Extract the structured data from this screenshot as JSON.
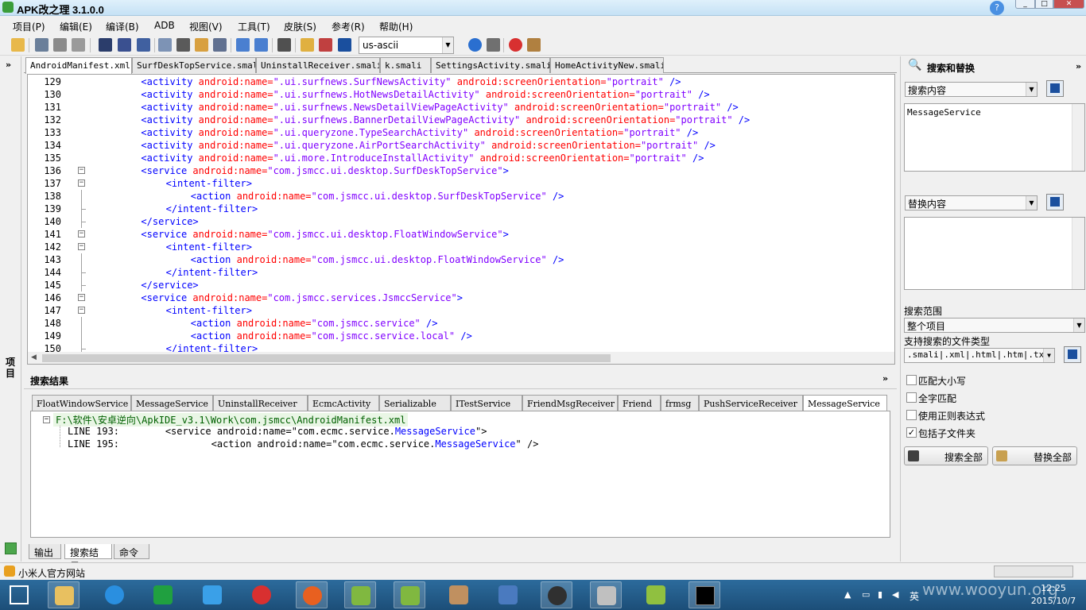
{
  "window": {
    "title": "APK改之理 3.1.0.0",
    "help_icon": "help-icon"
  },
  "menu": [
    "项目(P)",
    "编辑(E)",
    "编译(B)",
    "ADB",
    "视图(V)",
    "工具(T)",
    "皮肤(S)",
    "参考(R)",
    "帮助(H)"
  ],
  "toolbar": {
    "encoding": "us-ascii"
  },
  "left_panel": {
    "label": "项目"
  },
  "editor_tabs": [
    "AndroidManifest.xml",
    "SurfDeskTopService.smali",
    "UninstallReceiver.smali",
    "k.smali",
    "SettingsActivity.smali",
    "HomeActivityNew.smali"
  ],
  "editor": {
    "lines": [
      {
        "n": "129",
        "indent": 2,
        "parts": [
          [
            "t",
            "<activity "
          ],
          [
            "a",
            "android:name="
          ],
          [
            "v",
            "\".ui.surfnews.SurfNewsActivity\" "
          ],
          [
            "a",
            "android:screenOrientation="
          ],
          [
            "v",
            "\"portrait\" "
          ],
          [
            "t",
            "/>"
          ]
        ]
      },
      {
        "n": "130",
        "indent": 2,
        "parts": [
          [
            "t",
            "<activity "
          ],
          [
            "a",
            "android:name="
          ],
          [
            "v",
            "\".ui.surfnews.HotNewsDetailActivity\" "
          ],
          [
            "a",
            "android:screenOrientation="
          ],
          [
            "v",
            "\"portrait\" "
          ],
          [
            "t",
            "/>"
          ]
        ]
      },
      {
        "n": "131",
        "indent": 2,
        "parts": [
          [
            "t",
            "<activity "
          ],
          [
            "a",
            "android:name="
          ],
          [
            "v",
            "\".ui.surfnews.NewsDetailViewPageActivity\" "
          ],
          [
            "a",
            "android:screenOrientation="
          ],
          [
            "v",
            "\"portrait\" "
          ],
          [
            "t",
            "/>"
          ]
        ]
      },
      {
        "n": "132",
        "indent": 2,
        "parts": [
          [
            "t",
            "<activity "
          ],
          [
            "a",
            "android:name="
          ],
          [
            "v",
            "\".ui.surfnews.BannerDetailViewPageActivity\" "
          ],
          [
            "a",
            "android:screenOrientation="
          ],
          [
            "v",
            "\"portrait\" "
          ],
          [
            "t",
            "/>"
          ]
        ]
      },
      {
        "n": "133",
        "indent": 2,
        "parts": [
          [
            "t",
            "<activity "
          ],
          [
            "a",
            "android:name="
          ],
          [
            "v",
            "\".ui.queryzone.TypeSearchActivity\" "
          ],
          [
            "a",
            "android:screenOrientation="
          ],
          [
            "v",
            "\"portrait\" "
          ],
          [
            "t",
            "/>"
          ]
        ]
      },
      {
        "n": "134",
        "indent": 2,
        "parts": [
          [
            "t",
            "<activity "
          ],
          [
            "a",
            "android:name="
          ],
          [
            "v",
            "\".ui.queryzone.AirPortSearchActivity\" "
          ],
          [
            "a",
            "android:screenOrientation="
          ],
          [
            "v",
            "\"portrait\" "
          ],
          [
            "t",
            "/>"
          ]
        ]
      },
      {
        "n": "135",
        "indent": 2,
        "parts": [
          [
            "t",
            "<activity "
          ],
          [
            "a",
            "android:name="
          ],
          [
            "v",
            "\".ui.more.IntroduceInstallActivity\" "
          ],
          [
            "a",
            "android:screenOrientation="
          ],
          [
            "v",
            "\"portrait\" "
          ],
          [
            "t",
            "/>"
          ]
        ]
      },
      {
        "n": "136",
        "indent": 2,
        "fold": "box",
        "parts": [
          [
            "t",
            "<service "
          ],
          [
            "a",
            "android:name="
          ],
          [
            "v",
            "\"com.jsmcc.ui.desktop.SurfDeskTopService\""
          ],
          [
            "t",
            ">"
          ]
        ]
      },
      {
        "n": "137",
        "indent": 3,
        "fold": "box",
        "parts": [
          [
            "t",
            "<intent-filter>"
          ]
        ]
      },
      {
        "n": "138",
        "indent": 4,
        "fold": "line",
        "parts": [
          [
            "t",
            "<action "
          ],
          [
            "a",
            "android:name="
          ],
          [
            "v",
            "\"com.jsmcc.ui.desktop.SurfDeskTopService\" "
          ],
          [
            "t",
            "/>"
          ]
        ]
      },
      {
        "n": "139",
        "indent": 3,
        "fold": "end",
        "parts": [
          [
            "t",
            "</intent-filter>"
          ]
        ]
      },
      {
        "n": "140",
        "indent": 2,
        "fold": "end",
        "parts": [
          [
            "t",
            "</service>"
          ]
        ]
      },
      {
        "n": "141",
        "indent": 2,
        "fold": "box",
        "parts": [
          [
            "t",
            "<service "
          ],
          [
            "a",
            "android:name="
          ],
          [
            "v",
            "\"com.jsmcc.ui.desktop.FloatWindowService\""
          ],
          [
            "t",
            ">"
          ]
        ]
      },
      {
        "n": "142",
        "indent": 3,
        "fold": "box",
        "parts": [
          [
            "t",
            "<intent-filter>"
          ]
        ]
      },
      {
        "n": "143",
        "indent": 4,
        "fold": "line",
        "parts": [
          [
            "t",
            "<action "
          ],
          [
            "a",
            "android:name="
          ],
          [
            "v",
            "\"com.jsmcc.ui.desktop.FloatWindowService\" "
          ],
          [
            "t",
            "/>"
          ]
        ]
      },
      {
        "n": "144",
        "indent": 3,
        "fold": "end",
        "parts": [
          [
            "t",
            "</intent-filter>"
          ]
        ]
      },
      {
        "n": "145",
        "indent": 2,
        "fold": "end",
        "parts": [
          [
            "t",
            "</service>"
          ]
        ]
      },
      {
        "n": "146",
        "indent": 2,
        "fold": "box",
        "parts": [
          [
            "t",
            "<service "
          ],
          [
            "a",
            "android:name="
          ],
          [
            "v",
            "\"com.jsmcc.services.JsmccService\""
          ],
          [
            "t",
            ">"
          ]
        ]
      },
      {
        "n": "147",
        "indent": 3,
        "fold": "box",
        "parts": [
          [
            "t",
            "<intent-filter>"
          ]
        ]
      },
      {
        "n": "148",
        "indent": 4,
        "fold": "line",
        "parts": [
          [
            "t",
            "<action "
          ],
          [
            "a",
            "android:name="
          ],
          [
            "v",
            "\"com.jsmcc.service\" "
          ],
          [
            "t",
            "/>"
          ]
        ]
      },
      {
        "n": "149",
        "indent": 4,
        "fold": "line",
        "parts": [
          [
            "t",
            "<action "
          ],
          [
            "a",
            "android:name="
          ],
          [
            "v",
            "\"com.jsmcc.service.local\" "
          ],
          [
            "t",
            "/>"
          ]
        ]
      },
      {
        "n": "150",
        "indent": 3,
        "fold": "end",
        "parts": [
          [
            "t",
            "</intent-filter>"
          ]
        ]
      }
    ]
  },
  "results": {
    "title": "搜索结果",
    "tabs": [
      "FloatWindowService",
      "MessageService",
      "UninstallReceiver",
      "EcmcActivity",
      "Serializable",
      "ITestService",
      "FriendMsgReceiver",
      "Friend",
      "frmsg",
      "PushServiceReceiver",
      "MessageService"
    ],
    "file": "F:\\软件\\安卓逆向\\ApkIDE_v3.1\\Work\\com.jsmcc\\AndroidManifest.xml",
    "hits": [
      {
        "prefix": "LINE 193:        <service android:name=\"com.ecmc.service.",
        "match": "MessageService",
        "suffix": "\">"
      },
      {
        "prefix": "LINE 195:                <action android:name=\"com.ecmc.service.",
        "match": "MessageService",
        "suffix": "\" />"
      }
    ]
  },
  "bottom_tabs": [
    "输出",
    "搜索结果",
    "命令"
  ],
  "status": {
    "text": "小米人官方网站"
  },
  "search_panel": {
    "title": "搜索和替换",
    "search_label": "搜索内容",
    "search_text": "MessageService",
    "replace_label": "替换内容",
    "replace_text": "",
    "scope_label": "搜索范围",
    "scope_value": "整个项目",
    "types_label": "支持搜索的文件类型",
    "types_value": ".smali|.xml|.html|.htm|.txt",
    "options": [
      {
        "label": "匹配大小写",
        "checked": false
      },
      {
        "label": "全字匹配",
        "checked": false
      },
      {
        "label": "使用正则表达式",
        "checked": false
      },
      {
        "label": "包括子文件夹",
        "checked": true
      }
    ],
    "search_all": "搜索全部",
    "replace_all": "替换全部"
  },
  "taskbar": {
    "items": [
      "start-icon",
      "file-explorer-icon",
      "internet-explorer-icon",
      "store-icon",
      "feiq-icon",
      "netease-music-icon",
      "firefox-icon",
      "apk-ide-icon",
      "apk-ide-es-icon",
      "java-icon",
      "intellij-icon",
      "game-icon",
      "download-icon",
      "android-icon",
      "cmd-icon"
    ],
    "clock_time": "12:25",
    "clock_date": "2015/10/7",
    "ime": "英",
    "watermark": "www.wooyun.org"
  }
}
